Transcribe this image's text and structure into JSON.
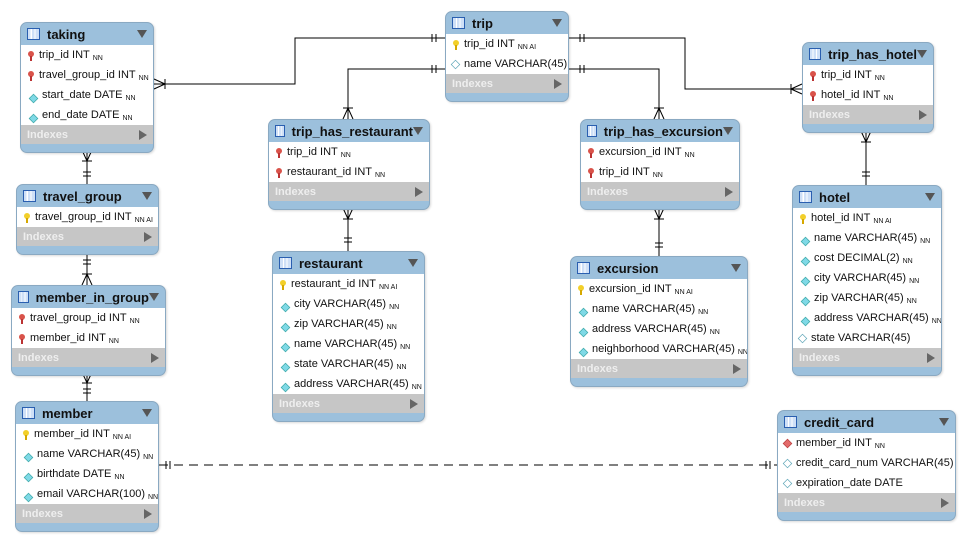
{
  "diagram": {
    "colors": {
      "header": "#9cc0dc",
      "indexes_bar": "#c6c6c6",
      "line": "#000000"
    },
    "indexes_label": "Indexes",
    "tables": [
      {
        "id": "taking",
        "name": "taking",
        "columns": [
          {
            "icon": "fk",
            "name": "trip_id INT",
            "flags": "NN"
          },
          {
            "icon": "fk",
            "name": "travel_group_id INT",
            "flags": "NN"
          },
          {
            "icon": "nn",
            "name": "start_date DATE",
            "flags": "NN"
          },
          {
            "icon": "nn",
            "name": "end_date DATE",
            "flags": "NN"
          }
        ]
      },
      {
        "id": "trip",
        "name": "trip",
        "columns": [
          {
            "icon": "pk",
            "name": "trip_id INT",
            "flags": "NN AI"
          },
          {
            "icon": "col",
            "name": "name VARCHAR(45)",
            "flags": ""
          }
        ]
      },
      {
        "id": "trip_has_hotel",
        "name": "trip_has_hotel",
        "columns": [
          {
            "icon": "fk",
            "name": "trip_id INT",
            "flags": "NN"
          },
          {
            "icon": "fk",
            "name": "hotel_id INT",
            "flags": "NN"
          }
        ]
      },
      {
        "id": "trip_has_restaurant",
        "name": "trip_has_restaurant",
        "columns": [
          {
            "icon": "fk",
            "name": "trip_id INT",
            "flags": "NN"
          },
          {
            "icon": "fk",
            "name": "restaurant_id INT",
            "flags": "NN"
          }
        ]
      },
      {
        "id": "trip_has_excursion",
        "name": "trip_has_excursion",
        "columns": [
          {
            "icon": "fk",
            "name": "excursion_id INT",
            "flags": "NN"
          },
          {
            "icon": "fk",
            "name": "trip_id INT",
            "flags": "NN"
          }
        ]
      },
      {
        "id": "travel_group",
        "name": "travel_group",
        "columns": [
          {
            "icon": "pk",
            "name": "travel_group_id INT",
            "flags": "NN AI"
          }
        ]
      },
      {
        "id": "hotel",
        "name": "hotel",
        "columns": [
          {
            "icon": "pk",
            "name": "hotel_id INT",
            "flags": "NN AI"
          },
          {
            "icon": "nn",
            "name": "name VARCHAR(45)",
            "flags": "NN"
          },
          {
            "icon": "nn",
            "name": "cost DECIMAL(2)",
            "flags": "NN"
          },
          {
            "icon": "nn",
            "name": "city VARCHAR(45)",
            "flags": "NN"
          },
          {
            "icon": "nn",
            "name": "zip VARCHAR(45)",
            "flags": "NN"
          },
          {
            "icon": "nn",
            "name": "address VARCHAR(45)",
            "flags": "NN"
          },
          {
            "icon": "col",
            "name": "state VARCHAR(45)",
            "flags": ""
          }
        ]
      },
      {
        "id": "restaurant",
        "name": "restaurant",
        "columns": [
          {
            "icon": "pk",
            "name": "restaurant_id INT",
            "flags": "NN AI"
          },
          {
            "icon": "nn",
            "name": "city VARCHAR(45)",
            "flags": "NN"
          },
          {
            "icon": "nn",
            "name": "zip VARCHAR(45)",
            "flags": "NN"
          },
          {
            "icon": "nn",
            "name": "name VARCHAR(45)",
            "flags": "NN"
          },
          {
            "icon": "nn",
            "name": "state VARCHAR(45)",
            "flags": "NN"
          },
          {
            "icon": "nn",
            "name": "address VARCHAR(45)",
            "flags": "NN"
          }
        ]
      },
      {
        "id": "excursion",
        "name": "excursion",
        "columns": [
          {
            "icon": "pk",
            "name": "excursion_id INT",
            "flags": "NN AI"
          },
          {
            "icon": "nn",
            "name": "name VARCHAR(45)",
            "flags": "NN"
          },
          {
            "icon": "nn",
            "name": "address VARCHAR(45)",
            "flags": "NN"
          },
          {
            "icon": "nn",
            "name": "neighborhood VARCHAR(45)",
            "flags": "NN"
          }
        ]
      },
      {
        "id": "member_in_group",
        "name": "member_in_group",
        "columns": [
          {
            "icon": "fk",
            "name": "travel_group_id INT",
            "flags": "NN"
          },
          {
            "icon": "fk",
            "name": "member_id INT",
            "flags": "NN"
          }
        ]
      },
      {
        "id": "member",
        "name": "member",
        "columns": [
          {
            "icon": "pk",
            "name": "member_id INT",
            "flags": "NN AI"
          },
          {
            "icon": "nn",
            "name": "name VARCHAR(45)",
            "flags": "NN"
          },
          {
            "icon": "nn",
            "name": "birthdate DATE",
            "flags": "NN"
          },
          {
            "icon": "nn",
            "name": "email VARCHAR(100)",
            "flags": "NN"
          }
        ]
      },
      {
        "id": "credit_card",
        "name": "credit_card",
        "columns": [
          {
            "icon": "fkcol",
            "name": "member_id INT",
            "flags": "NN"
          },
          {
            "icon": "col",
            "name": "credit_card_num VARCHAR(45)",
            "flags": ""
          },
          {
            "icon": "col",
            "name": "expiration_date DATE",
            "flags": ""
          }
        ]
      }
    ],
    "relationships": [
      {
        "from": "trip",
        "to": "taking",
        "style": "identifying"
      },
      {
        "from": "trip",
        "to": "trip_has_restaurant",
        "style": "identifying"
      },
      {
        "from": "trip",
        "to": "trip_has_excursion",
        "style": "identifying"
      },
      {
        "from": "trip",
        "to": "trip_has_hotel",
        "style": "identifying"
      },
      {
        "from": "restaurant",
        "to": "trip_has_restaurant",
        "style": "identifying"
      },
      {
        "from": "excursion",
        "to": "trip_has_excursion",
        "style": "identifying"
      },
      {
        "from": "hotel",
        "to": "trip_has_hotel",
        "style": "identifying"
      },
      {
        "from": "travel_group",
        "to": "taking",
        "style": "identifying"
      },
      {
        "from": "travel_group",
        "to": "member_in_group",
        "style": "identifying"
      },
      {
        "from": "member",
        "to": "member_in_group",
        "style": "identifying"
      },
      {
        "from": "member",
        "to": "credit_card",
        "style": "non-identifying"
      }
    ]
  }
}
